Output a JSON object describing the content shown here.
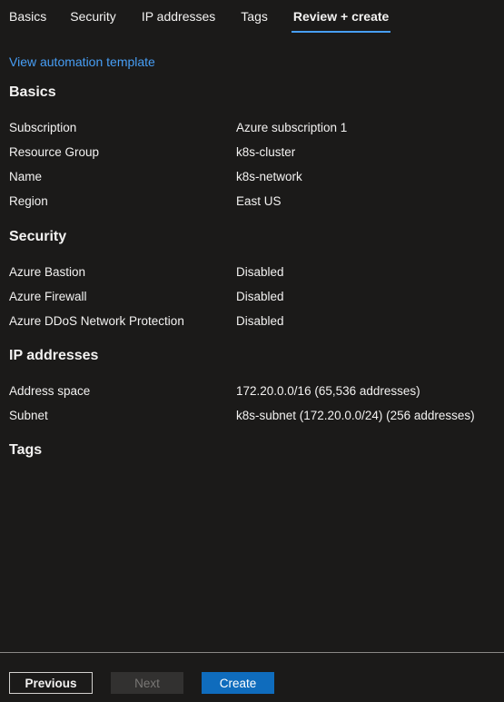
{
  "tabs": [
    {
      "label": "Basics"
    },
    {
      "label": "Security"
    },
    {
      "label": "IP addresses"
    },
    {
      "label": "Tags"
    },
    {
      "label": "Review + create"
    }
  ],
  "automation_link": "View automation template",
  "sections": {
    "basics": {
      "title": "Basics",
      "rows": [
        {
          "label": "Subscription",
          "value": "Azure subscription 1"
        },
        {
          "label": "Resource Group",
          "value": "k8s-cluster"
        },
        {
          "label": "Name",
          "value": "k8s-network"
        },
        {
          "label": "Region",
          "value": "East US"
        }
      ]
    },
    "security": {
      "title": "Security",
      "rows": [
        {
          "label": "Azure Bastion",
          "value": "Disabled"
        },
        {
          "label": "Azure Firewall",
          "value": "Disabled"
        },
        {
          "label": "Azure DDoS Network Protection",
          "value": "Disabled"
        }
      ]
    },
    "ip": {
      "title": "IP addresses",
      "rows": [
        {
          "label": "Address space",
          "value": "172.20.0.0/16 (65,536 addresses)"
        },
        {
          "label": "Subnet",
          "value": "k8s-subnet (172.20.0.0/24) (256 addresses)"
        }
      ]
    },
    "tags": {
      "title": "Tags"
    }
  },
  "footer": {
    "previous_label": "Previous",
    "next_label": "Next",
    "create_label": "Create"
  },
  "colors": {
    "background": "#1b1a19",
    "link": "#479ef5",
    "primary_button": "#0f6cbd"
  }
}
